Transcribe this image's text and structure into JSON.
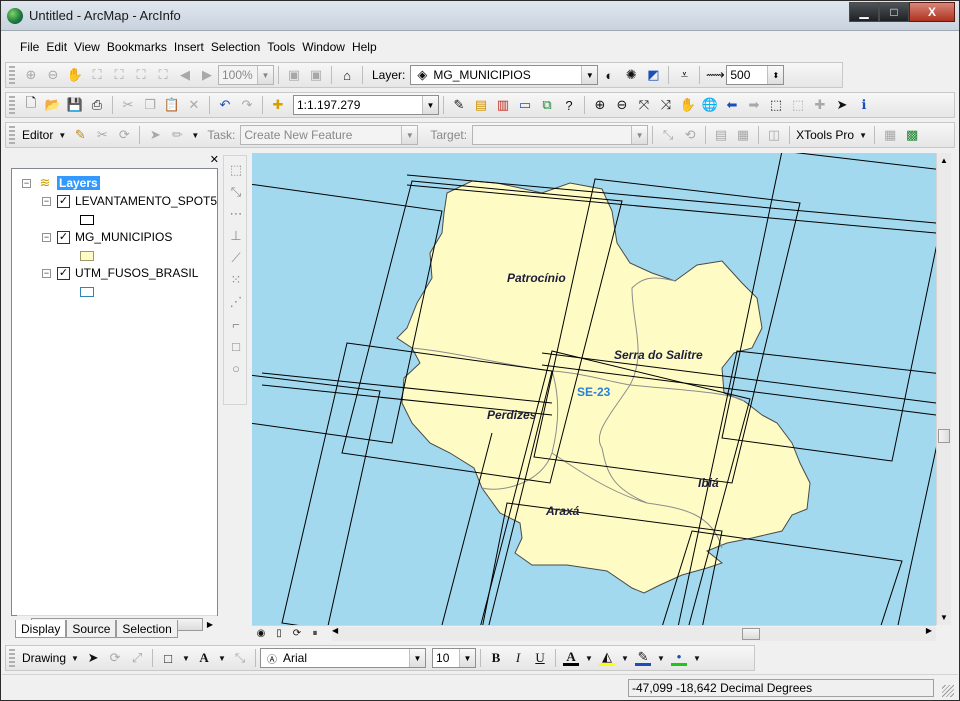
{
  "window": {
    "title": "Untitled - ArcMap - ArcInfo",
    "minimize": "▁",
    "maximize": "□",
    "close": "X"
  },
  "menu": [
    "File",
    "Edit",
    "View",
    "Bookmarks",
    "Insert",
    "Selection",
    "Tools",
    "Window",
    "Help"
  ],
  "toolbar1": {
    "zoom_value": "100%",
    "layer_label": "Layer:",
    "layer_value": "MG_MUNICIPIOS",
    "distance_value": "500"
  },
  "toolbar2": {
    "scale_value": "1:1.197.279"
  },
  "editor_bar": {
    "editor_label": "Editor",
    "task_label": "Task:",
    "task_value": "Create New Feature",
    "target_label": "Target:",
    "target_value": "",
    "xtools_label": "XTools Pro"
  },
  "toc": {
    "root_label": "Layers",
    "layers": [
      {
        "name": "LEVANTAMENTO_SPOT5",
        "checked": true,
        "fill": "#ffffff",
        "border": "#000000"
      },
      {
        "name": "MG_MUNICIPIOS",
        "checked": true,
        "fill": "#fefcc4",
        "border": "#9a9a6a"
      },
      {
        "name": "UTM_FUSOS_BRASIL",
        "checked": true,
        "fill": "#ffffff",
        "border": "#2d86b5"
      }
    ],
    "tabs": [
      "Display",
      "Source",
      "Selection"
    ],
    "active_tab": "Display"
  },
  "map": {
    "water_color": "#a2d9ef",
    "land_color": "#fefcc4",
    "labels": {
      "patrocinio": "Patrocínio",
      "serra": "Serra do Salitre",
      "perdizes": "Perdizes",
      "araxa": "Araxá",
      "ibia": "Ibiá",
      "zone": "SE-23"
    }
  },
  "drawing_bar": {
    "drawing_label": "Drawing",
    "font_value": "Arial",
    "size_value": "10",
    "bold": "B",
    "italic": "I",
    "underline": "U"
  },
  "status": {
    "coords": "-47,099  -18,642 Decimal Degrees"
  }
}
